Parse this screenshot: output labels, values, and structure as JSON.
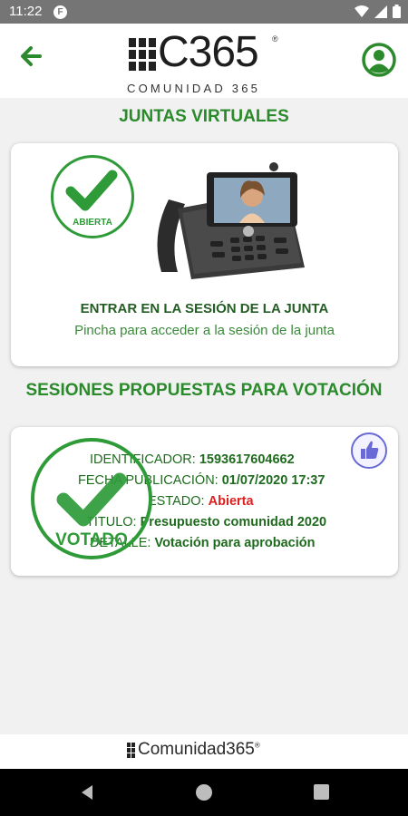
{
  "status_bar": {
    "time": "11:22",
    "notification_glyph": "F"
  },
  "header": {
    "logo_text": "C365",
    "logo_registered": "®",
    "logo_subtitle": "COMUNIDAD 365"
  },
  "sections": {
    "virtual_meetings_title": "JUNTAS VIRTUALES",
    "voting_sessions_title": "SESIONES PROPUESTAS PARA VOTACIÓN"
  },
  "meeting_card": {
    "status_badge": "ABIERTA",
    "title": "ENTRAR EN LA SESIÓN DE LA JUNTA",
    "subtitle": "Pincha para acceder a la sesión de la junta"
  },
  "vote_card": {
    "voted_badge": "VOTADO",
    "fields": [
      {
        "label": "IDENTIFICADOR:",
        "value": "1593617604662"
      },
      {
        "label": "FECHA PUBLICACIÓN:",
        "value": "01/07/2020 17:37"
      },
      {
        "label": "ESTADO:",
        "value": "Abierta"
      },
      {
        "label": "TITULO:",
        "value": "Presupuesto comunidad 2020"
      },
      {
        "label": "DETALLE:",
        "value": "Votación para aprobación"
      }
    ]
  },
  "footer": {
    "brand_text": "Comunidad",
    "brand_number": "365",
    "brand_registered": "®"
  },
  "colors": {
    "brand_green": "#2b8a2b",
    "status_open_red": "#e02020",
    "like_purple": "#6a6ad6"
  },
  "icons": {
    "back": "arrow-left-icon",
    "profile": "user-circle-icon",
    "check": "checkmark-icon",
    "phone": "video-phone-icon",
    "like": "thumbs-up-icon"
  }
}
